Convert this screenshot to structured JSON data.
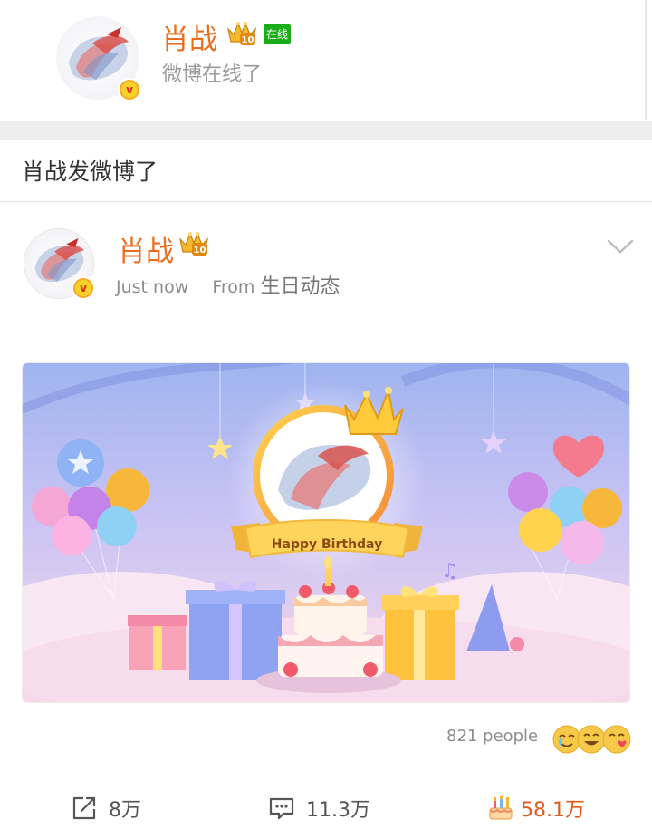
{
  "header": {
    "name": "肖战",
    "online_label": "在线",
    "status_text": "微博在线了",
    "verified_badge": "v",
    "crown_badge_number": "10"
  },
  "section": {
    "title": "肖战发微博了"
  },
  "post": {
    "author": "肖战",
    "time": "Just now",
    "from_label": "From",
    "source": "生日动态",
    "banner_text": "Happy Birthday",
    "reactions_count": "821 people",
    "actions": {
      "repost": "8万",
      "comment": "11.3万",
      "like": "58.1万"
    }
  },
  "colors": {
    "accent_orange": "#ee6b1c",
    "online_green": "#1aad19",
    "like_orange": "#e05a1c"
  },
  "icons": [
    "verified-v-icon",
    "crown-level-icon",
    "chevron-down-icon",
    "share-icon",
    "comment-icon",
    "birthday-cake-icon"
  ]
}
